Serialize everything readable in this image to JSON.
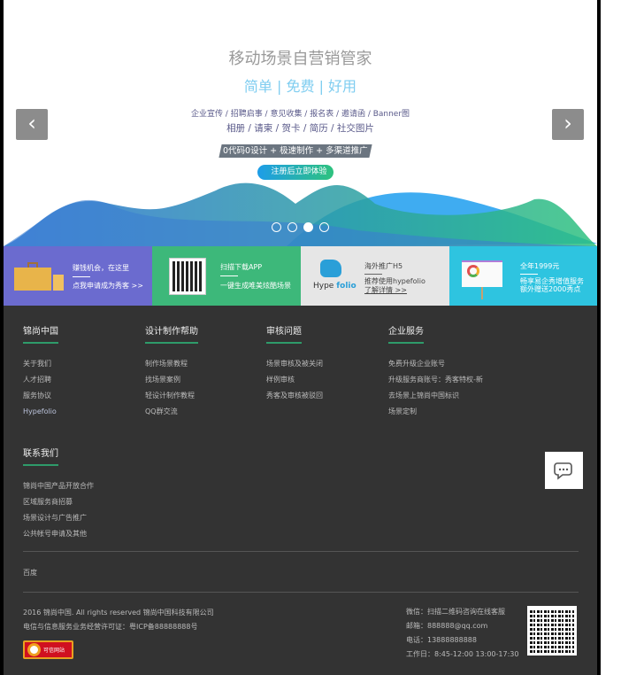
{
  "banner": {
    "title": "移动场景自营销管家",
    "tagline": "简单 | 免费 | 好用",
    "types_line1": "企业宣传 / 招聘启事 / 意见收集 / 报名表 / 邀请函 / Banner图",
    "types_line2": "相册 / 请柬 / 贺卡 / 简历 / 社交图片",
    "slogan": "0代码0设计 + 极速制作 + 多渠道推广",
    "cta": "注册后立即体验",
    "prev": "‹",
    "next": "›",
    "slides": 4,
    "active_slide": 3
  },
  "cards": [
    {
      "line1": "赚钱机会，在这里",
      "line2": "点我申请成为秀客 >>",
      "color": "#6b6bcf"
    },
    {
      "line1": "扫描下载APP",
      "line2": "一键生成唯美炫酷场景",
      "color": "#3db87a"
    },
    {
      "line1": "海外推广H5",
      "line2": "推荐使用hypefolio",
      "line3": "了解详情 >>",
      "logo_a": "Hype",
      "logo_b": "folio",
      "color": "#e6e6e6"
    },
    {
      "line1": "全年1999元",
      "line2": "畅享易企秀增值服务",
      "line3": "额外赠送2000秀点",
      "color": "#2ec4e0"
    }
  ],
  "footer": {
    "columns": [
      {
        "title": "锦尚中国",
        "links": [
          "关于我们",
          "人才招聘",
          "服务协议",
          "Hypefolio"
        ]
      },
      {
        "title": "设计制作帮助",
        "links": [
          "制作场景教程",
          "找场景案例",
          "轻设计制作教程",
          "QQ群交流"
        ]
      },
      {
        "title": "审核问题",
        "links": [
          "场景审核及被关闭",
          "样例审核",
          "秀客及审核被驳回"
        ]
      },
      {
        "title": "企业服务",
        "links": [
          "免费升级企业账号",
          "升级服务商账号：秀客特权-新",
          "去场景上锦尚中国标识",
          "场景定制"
        ]
      }
    ],
    "contact": {
      "title": "联系我们",
      "links": [
        "锦尚中国产品开放合作",
        "区域服务商招募",
        "场景设计与广告推广",
        "公共帐号申请及其他"
      ]
    },
    "friend_link": "百度",
    "copyright": "2016 锦尚中国. All rights reserved 锦尚中国科技有限公司",
    "icp": "电信与信息服务业务经营许可证：粤ICP备88888888号",
    "badge": "可信网站",
    "wechat": "微信：扫描二维码咨询在线客服",
    "email": "邮箱：888888@qq.com",
    "phone": "电话：13888888888",
    "hours": "工作日：8:45-12:00 13:00-17:30"
  }
}
